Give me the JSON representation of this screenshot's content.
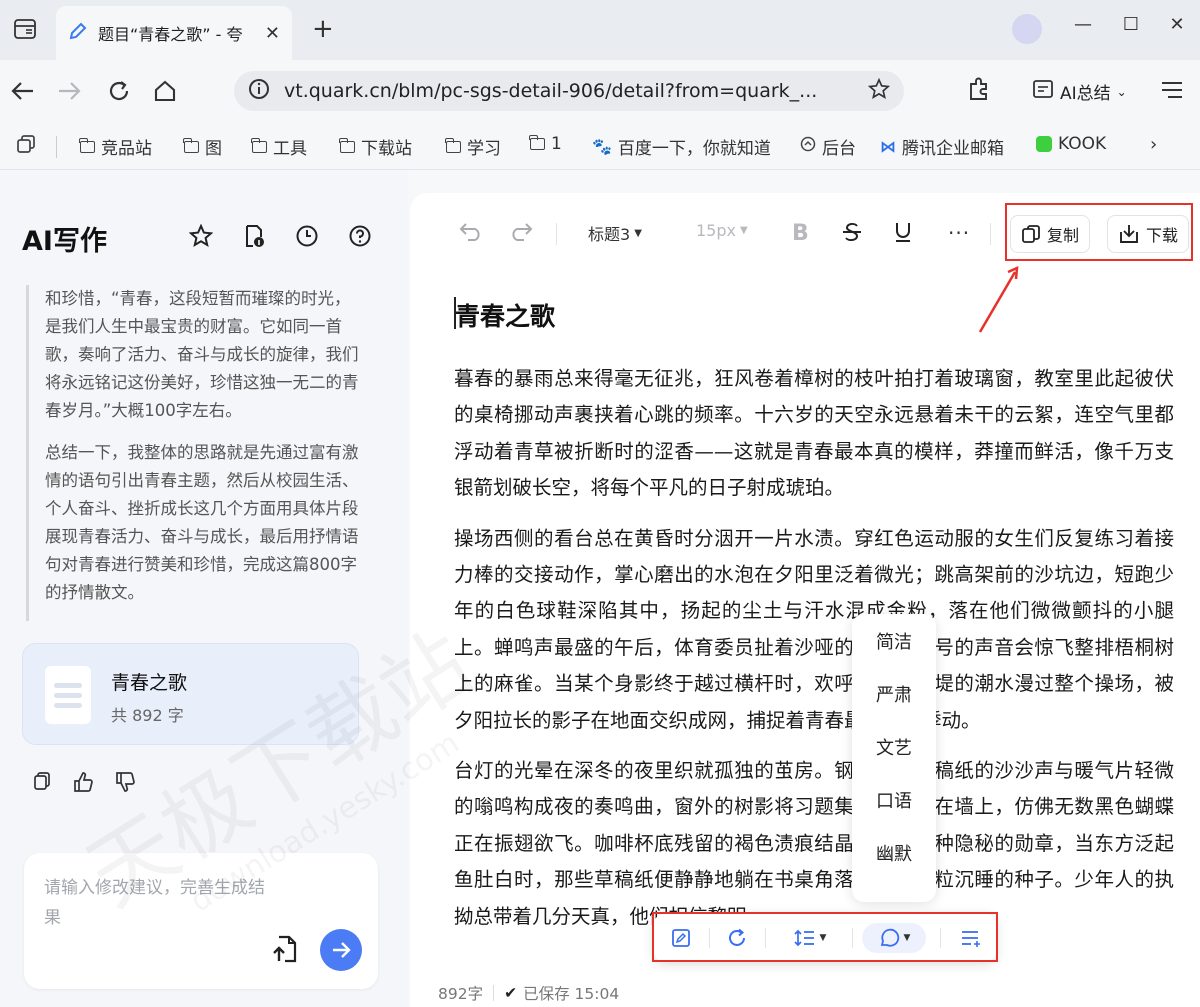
{
  "browser": {
    "tab_title": "题目“青春之歌” - 夸",
    "url": "vt.quark.cn/blm/pc-sgs-detail-906/detail?from=quark_...",
    "ai_summary_label": "AI总结",
    "bookmarks": [
      "竞品站",
      "图",
      "工具",
      "下载站",
      "学习",
      "1",
      "百度一下，你就知道",
      "后台",
      "腾讯企业邮箱",
      "KOOK"
    ]
  },
  "left_panel": {
    "title": "AI写作",
    "chat_paragraphs": [
      "和珍惜，“青春，这段短暂而璀璨的时光，是我们人生中最宝贵的财富。它如同一首歌，奏响了活力、奋斗与成长的旋律，我们将永远铭记这份美好，珍惜这独一无二的青春岁月。”大概100字左右。",
      "总结一下，我整体的思路就是先通过富有激情的语句引出青春主题，然后从校园生活、个人奋斗、挫折成长这几个方面用具体片段展现青春活力、奋斗与成长，最后用抒情语句对青春进行赞美和珍惜，完成这篇800字的抒情散文。"
    ],
    "doc_card": {
      "name": "青春之歌",
      "count": "共 892 字"
    },
    "input_placeholder": "请输入修改建议，完善生成结果"
  },
  "editor": {
    "heading_select": "标题3",
    "font_size": "15px",
    "copy_label": "复制",
    "download_label": "下载",
    "title": "青春之歌",
    "paragraphs": [
      "暮春的暴雨总来得毫无征兆，狂风卷着樟树的枝叶拍打着玻璃窗，教室里此起彼伏的桌椅挪动声裹挟着心跳的频率。十六岁的天空永远悬着未干的云絮，连空气里都浮动着青草被折断时的涩香——这就是青春最本真的模样，莽撞而鲜活，像千万支银箭划破长空，将每个平凡的日子射成琥珀。",
      "操场西侧的看台总在黄昏时分洇开一片水渍。穿红色运动服的女生们反复练习着接力棒的交接动作，掌心磨出的水泡在夕阳里泛着微光；跳高架前的沙坑边，短跑少年的白色球鞋深陷其中，扬起的尘土与汗水混成金粉，落在他们微微颤抖的小腿上。蝉鸣声最盛的午后，体育委员扯着沙哑的嗓子喊口号的声音会惊飞整排梧桐树上的麻雀。当某个身影终于越过横杆时，欢呼声便像决堤的潮水漫过整个操场，被夕阳拉长的影子在地面交织成网，捕捉着青春最原始的悸动。",
      "台灯的光晕在深冬的夜里织就孤独的茧房。钢笔划过草稿纸的沙沙声与暖气片轻微的嗡鸣构成夜的奏鸣曲，窗外的树影将习题集的阴影投在墙上，仿佛无数黑色蝴蝶正在振翅欲飞。咖啡杯底残留的褐色渍痕结晶凝固成某种隐秘的勋章，当东方泛起鱼肚白时，那些草稿纸便静静地躺在书桌角落，像一粒粒沉睡的种子。少年人的执拗总带着几分天真，他们相信黎明"
    ],
    "style_options": [
      "简洁",
      "严肃",
      "文艺",
      "口语",
      "幽默"
    ],
    "status_words": "892字",
    "status_saved": "已保存 15:04"
  },
  "watermark": {
    "main": "天极下载站",
    "sub": "download.yesky.com"
  },
  "colors": {
    "accent": "#4b7cf5",
    "highlight_box": "#e8312a"
  }
}
